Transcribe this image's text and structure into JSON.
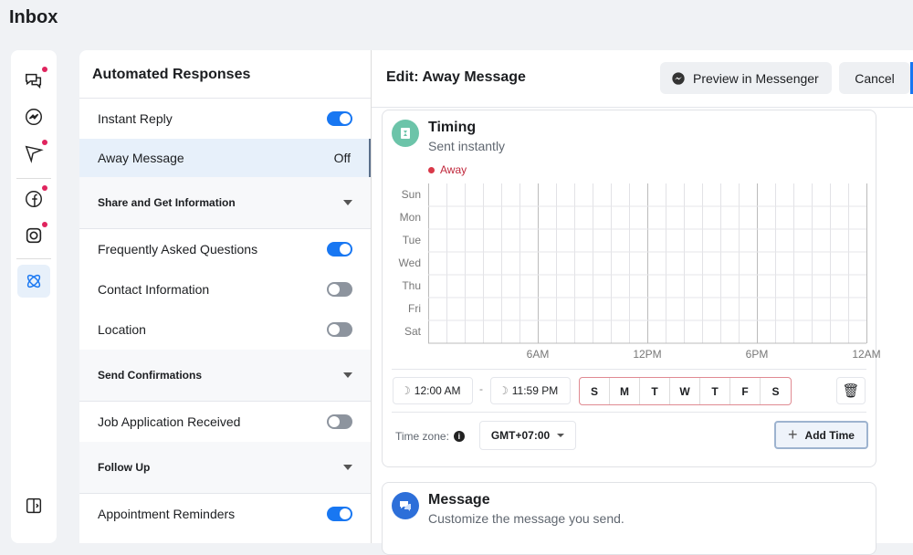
{
  "page_title": "Inbox",
  "rail": {
    "icons": [
      "chat-bubbles-icon",
      "messenger-icon",
      "send-icon",
      "facebook-icon",
      "instagram-icon",
      "automation-icon",
      "collapse-panel-icon"
    ]
  },
  "sidebar": {
    "title": "Automated Responses",
    "items": [
      {
        "type": "item",
        "label": "Instant Reply",
        "toggle": true
      },
      {
        "type": "item",
        "label": "Away Message",
        "status": "Off",
        "selected": true
      },
      {
        "type": "section",
        "label": "Share and Get Information"
      },
      {
        "type": "item",
        "label": "Frequently Asked Questions",
        "toggle": true
      },
      {
        "type": "item",
        "label": "Contact Information",
        "toggle": false
      },
      {
        "type": "item",
        "label": "Location",
        "toggle": false
      },
      {
        "type": "section",
        "label": "Send Confirmations"
      },
      {
        "type": "item",
        "label": "Job Application Received",
        "toggle": false
      },
      {
        "type": "section",
        "label": "Follow Up"
      },
      {
        "type": "item",
        "label": "Appointment Reminders",
        "toggle": true
      }
    ]
  },
  "editor": {
    "title": "Edit: Away Message",
    "preview_label": "Preview in Messenger",
    "cancel_label": "Cancel",
    "timing": {
      "title": "Timing",
      "subtitle": "Sent instantly",
      "legend": "Away",
      "days": [
        "Sun",
        "Mon",
        "Tue",
        "Wed",
        "Thu",
        "Fri",
        "Sat"
      ],
      "time_ticks": [
        "6AM",
        "12PM",
        "6PM",
        "12AM"
      ],
      "start_time": "12:00 AM",
      "separator": "-",
      "end_time": "11:59 PM",
      "weekday_buttons": [
        "S",
        "M",
        "T",
        "W",
        "T",
        "F",
        "S"
      ],
      "timezone_label": "Time zone:",
      "timezone_value": "GMT+07:00",
      "add_time_label": "Add Time"
    },
    "message": {
      "title": "Message",
      "subtitle": "Customize the message you send."
    }
  },
  "colors": {
    "accent": "#1877f2",
    "away": "#d93848",
    "timing_icon": "#6cc4a9"
  }
}
